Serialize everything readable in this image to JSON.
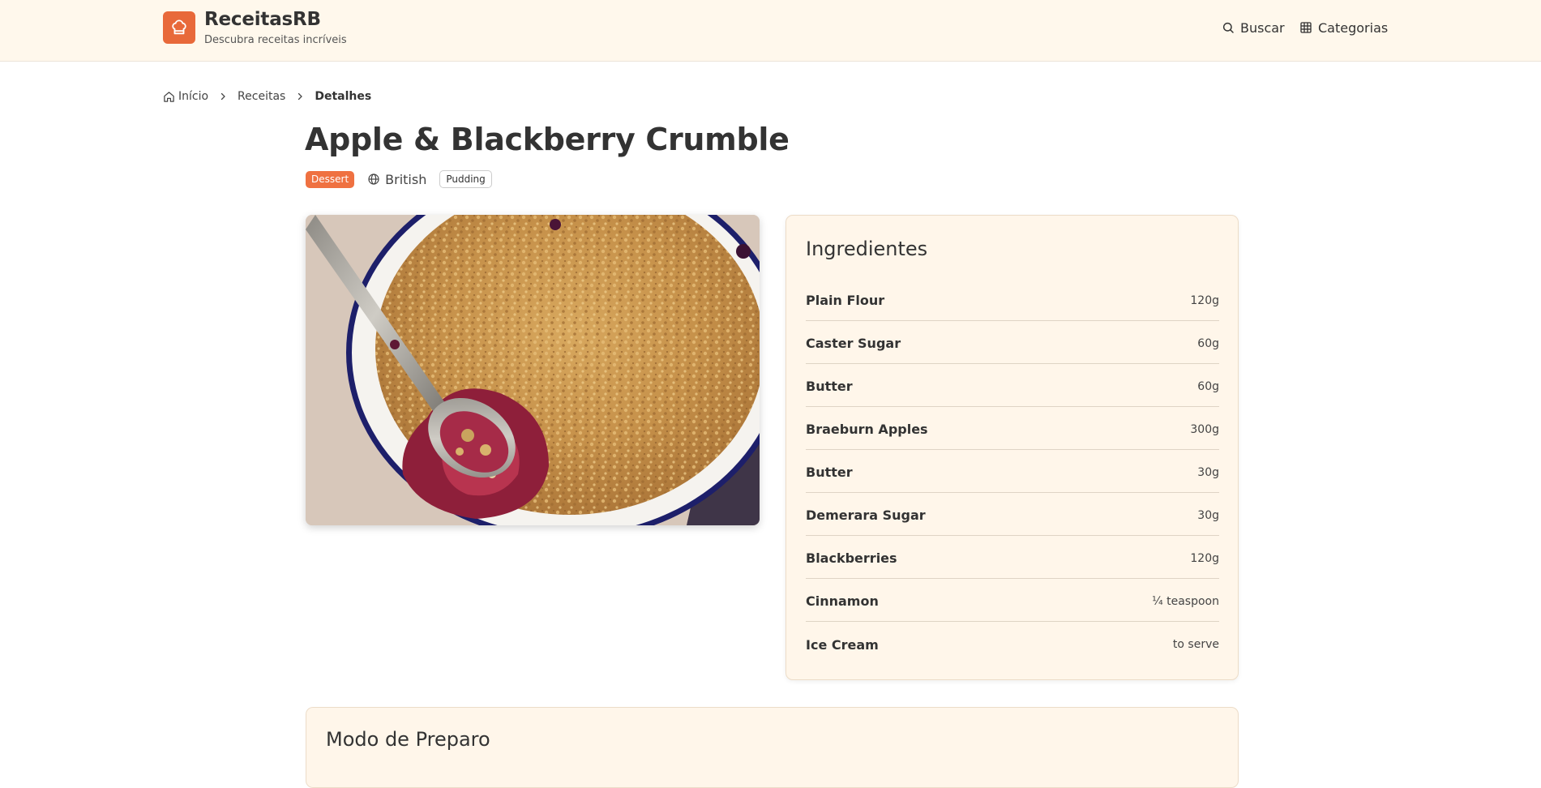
{
  "brand": {
    "name": "ReceitasRB",
    "tagline": "Descubra receitas incríveis",
    "accent_color": "#e8693a",
    "logo_icon": "chef-hat-icon"
  },
  "nav": {
    "search_label": "Buscar",
    "search_icon": "search-icon",
    "categories_label": "Categorias",
    "categories_icon": "grid-icon"
  },
  "breadcrumb": {
    "home": "Início",
    "recipes": "Receitas",
    "current": "Detalhes"
  },
  "recipe": {
    "title": "Apple & Blackberry Crumble",
    "category": "Dessert",
    "category_color": "#ef7141",
    "origin": "British",
    "origin_icon": "globe-icon",
    "tag": "Pudding"
  },
  "ingredients": {
    "title": "Ingredientes",
    "items": [
      {
        "name": "Plain Flour",
        "measure": "120g"
      },
      {
        "name": "Caster Sugar",
        "measure": "60g"
      },
      {
        "name": "Butter",
        "measure": "60g"
      },
      {
        "name": "Braeburn Apples",
        "measure": "300g"
      },
      {
        "name": "Butter",
        "measure": "30g"
      },
      {
        "name": "Demerara Sugar",
        "measure": "30g"
      },
      {
        "name": "Blackberries",
        "measure": "120g"
      },
      {
        "name": "Cinnamon",
        "measure": "¼ teaspoon"
      },
      {
        "name": "Ice Cream",
        "measure": "to serve"
      }
    ]
  },
  "preparation": {
    "title": "Modo de Preparo"
  }
}
